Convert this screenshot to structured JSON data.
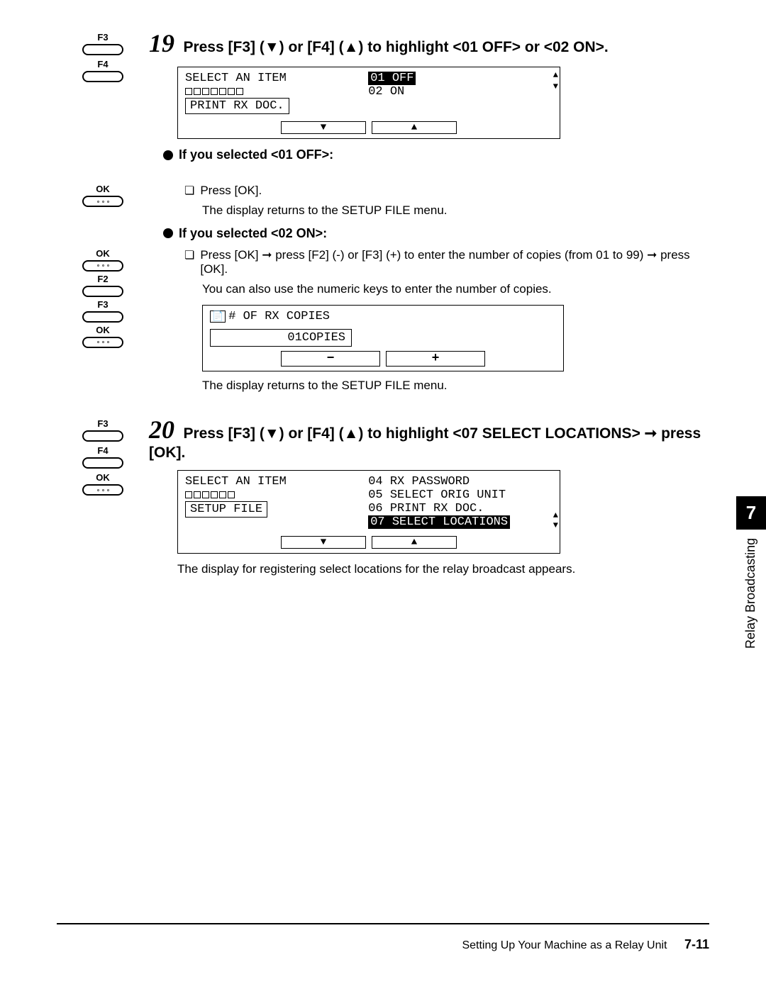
{
  "keys": {
    "f2": "F2",
    "f3": "F3",
    "f4": "F4",
    "ok": "OK"
  },
  "step19": {
    "num": "19",
    "title": "Press [F3] (▼) or [F4] (▲) to highlight <01 OFF> or <02 ON>.",
    "lcd": {
      "left_title": "SELECT AN ITEM",
      "left_box": "PRINT RX DOC.",
      "opt1": "01 OFF",
      "opt2": "02 ON",
      "down": "▼",
      "up": "▲",
      "sup": "▲",
      "sdn": "▼"
    },
    "sub_off": {
      "heading": "If you selected <01 OFF>:",
      "b1": "Press [OK].",
      "b1_desc": "The display returns to the SETUP FILE menu."
    },
    "sub_on": {
      "heading": "If you selected <02 ON>:",
      "b1": "Press [OK] ➞ press [F2] (-) or [F3] (+) to enter the number of copies (from 01 to 99) ➞ press [OK].",
      "b1_desc": "You can also use the numeric keys to enter the number of copies.",
      "lcd_title": "# OF RX COPIES",
      "lcd_val": "01COPIES",
      "minus": "−",
      "plus": "+",
      "b2_desc": "The display returns to the SETUP FILE menu."
    }
  },
  "step20": {
    "num": "20",
    "title": "Press [F3] (▼) or [F4] (▲) to highlight <07 SELECT LOCATIONS> ➞ press [OK].",
    "lcd": {
      "left_title": "SELECT AN ITEM",
      "left_box": "SETUP FILE",
      "r1": "04 RX PASSWORD",
      "r2": "05 SELECT ORIG UNIT",
      "r3": "06 PRINT RX DOC.",
      "r4": "07 SELECT LOCATIONS",
      "down": "▼",
      "up": "▲",
      "sup": "▲",
      "sdn": "▼"
    },
    "desc": "The display for registering select locations for the relay broadcast appears."
  },
  "tab": {
    "num": "7",
    "label": "Relay Broadcasting"
  },
  "footer": {
    "text": "Setting Up Your Machine as a Relay Unit",
    "page": "7-11"
  }
}
